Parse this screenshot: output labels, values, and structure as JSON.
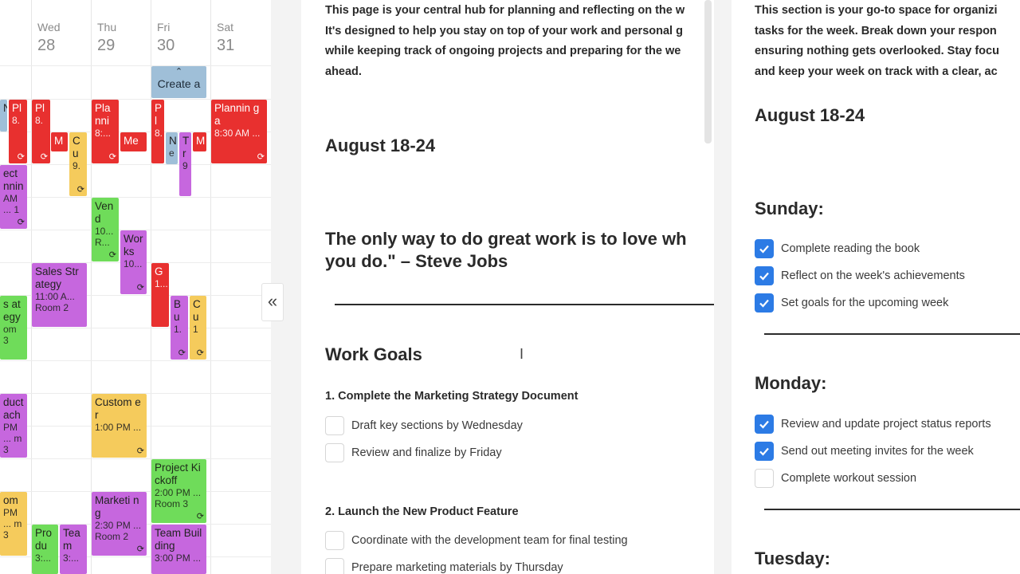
{
  "calendar": {
    "days": [
      {
        "name": "Wed",
        "num": "28"
      },
      {
        "name": "Thu",
        "num": "29"
      },
      {
        "name": "Fri",
        "num": "30"
      },
      {
        "name": "Sat",
        "num": "31"
      }
    ],
    "create_label": "Create a",
    "events": {
      "e1": {
        "title": "N",
        "sub": ""
      },
      "e2": {
        "title": "Pl",
        "sub": "8."
      },
      "e3": {
        "title": "Pl",
        "sub": "8."
      },
      "e4": {
        "title": "M",
        "sub": ""
      },
      "e5": {
        "title": "Cu",
        "sub": "9."
      },
      "e6": {
        "title": "Planni",
        "sub": "8:..."
      },
      "e7": {
        "title": "Me",
        "sub": ""
      },
      "e8": {
        "title": "Pl",
        "sub": "8."
      },
      "e9": {
        "title": "N",
        "sub": "e"
      },
      "e10": {
        "title": "Tr",
        "sub": "9"
      },
      "e11": {
        "title": "M",
        "sub": ""
      },
      "e12": {
        "title": "Plannin g a",
        "sub": "8:30 AM ..."
      },
      "e13": {
        "title": "ect nnin",
        "sub": "AM ... 1"
      },
      "e14": {
        "title": "Vend",
        "sub": "10... R..."
      },
      "e15": {
        "title": "Works",
        "sub": "10..."
      },
      "e16": {
        "title": "Sales Strategy",
        "sub": "11:00 A... Room 2"
      },
      "e17": {
        "title": "G",
        "sub": "1..."
      },
      "e18": {
        "title": "s ategy",
        "sub": "om 3"
      },
      "e19": {
        "title": "B u",
        "sub": "1."
      },
      "e20": {
        "title": "C u",
        "sub": "1"
      },
      "e21": {
        "title": "duct ach",
        "sub": "PM ... m 3"
      },
      "e22": {
        "title": "Custom er",
        "sub": "1:00 PM ..."
      },
      "e23": {
        "title": "Project Kickoff",
        "sub": "2:00 PM ... Room 3"
      },
      "e24": {
        "title": "om",
        "sub": "PM ... m 3"
      },
      "e25": {
        "title": "Marketi ng",
        "sub": "2:30 PM ... Room 2"
      },
      "e26": {
        "title": "Pro du",
        "sub": "3:..."
      },
      "e27": {
        "title": "Tea m",
        "sub": "3:..."
      },
      "e28": {
        "title": "Team Building",
        "sub": "3:00 PM ..."
      }
    }
  },
  "middle_doc": {
    "intro": [
      "This page is your central hub for planning and reflecting on the w",
      "It's designed to help you stay on top of your work and personal g",
      "while keeping track of ongoing projects and preparing for the we",
      "ahead."
    ],
    "date_heading": "August 18-24",
    "quote_line1": "The only way to do great work is to love wh",
    "quote_line2": "you do.\" – Steve Jobs",
    "work_goals_heading": "Work Goals",
    "goal1": {
      "title": "1. Complete the Marketing Strategy Document",
      "tasks": [
        {
          "label": "Draft key sections by Wednesday",
          "checked": false
        },
        {
          "label": "Review and finalize by Friday",
          "checked": false
        }
      ]
    },
    "goal2": {
      "title": "2. Launch the New Product Feature",
      "tasks": [
        {
          "label": "Coordinate with the development team for final testing",
          "checked": false
        },
        {
          "label": "Prepare marketing materials by Thursday",
          "checked": false
        }
      ]
    }
  },
  "right_doc": {
    "intro": [
      "This section is your go-to space for organizi",
      "tasks for the week. Break down your respon",
      "ensuring nothing gets overlooked. Stay focu",
      "and keep your week on track with a clear, ac"
    ],
    "date_heading": "August 18-24",
    "sunday": {
      "heading": "Sunday:",
      "tasks": [
        {
          "label": "Complete reading the book",
          "checked": true
        },
        {
          "label": "Reflect on the week's achievements",
          "checked": true
        },
        {
          "label": "Set goals for the upcoming week",
          "checked": true
        }
      ]
    },
    "monday": {
      "heading": "Monday:",
      "tasks": [
        {
          "label": "Review and update project status reports",
          "checked": true
        },
        {
          "label": "Send out meeting invites for the week",
          "checked": true
        },
        {
          "label": "Complete workout session",
          "checked": false
        }
      ]
    },
    "tuesday": {
      "heading": "Tuesday:"
    }
  },
  "colors": {
    "checkbox_checked": "#2c7be5",
    "event_red": "#e8302f",
    "event_purple": "#c667de",
    "event_green": "#6fdc5a",
    "event_yellow": "#f5cb5c",
    "event_blue": "#9fbfd8"
  },
  "icons": {
    "collapse": "double-chevron-left-icon",
    "recurring": "recurring-icon",
    "check": "check-icon",
    "cursor": "text-cursor-icon"
  }
}
